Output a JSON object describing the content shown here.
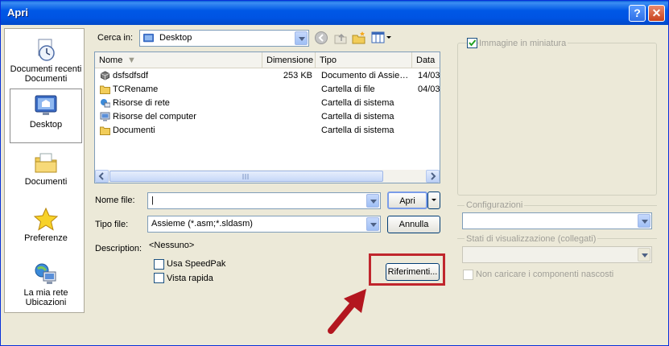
{
  "window": {
    "title": "Apri"
  },
  "title_buttons": {
    "help": "?",
    "close": "✕"
  },
  "places": [
    {
      "label": "Documenti recenti Documenti",
      "icon": "recent-documents-icon"
    },
    {
      "label": "Desktop",
      "icon": "desktop-icon"
    },
    {
      "label": "Documenti",
      "icon": "documents-folder-icon"
    },
    {
      "label": "Preferenze",
      "icon": "favorites-star-icon"
    },
    {
      "label": "La mia rete Ubicazioni",
      "icon": "network-places-icon"
    }
  ],
  "look_in": {
    "label": "Cerca in:",
    "value": "Desktop"
  },
  "file_list": {
    "columns": [
      "Nome",
      "Dimensione",
      "Tipo",
      "Data"
    ],
    "rows": [
      {
        "name": "dsfsdfsdf",
        "size": "253 KB",
        "type": "Documento di Assie…",
        "date": "14/03",
        "icon": "assembly-file-icon"
      },
      {
        "name": "TCRename",
        "size": "",
        "type": "Cartella di file",
        "date": "04/03",
        "icon": "folder-icon"
      },
      {
        "name": "Risorse di rete",
        "size": "",
        "type": "Cartella di sistema",
        "date": "",
        "icon": "network-icon"
      },
      {
        "name": "Risorse del computer",
        "size": "",
        "type": "Cartella di sistema",
        "date": "",
        "icon": "computer-icon"
      },
      {
        "name": "Documenti",
        "size": "",
        "type": "Cartella di sistema",
        "date": "",
        "icon": "folder-icon"
      }
    ]
  },
  "file_name": {
    "label": "Nome file:",
    "value": "|"
  },
  "file_type": {
    "label": "Tipo file:",
    "value": "Assieme (*.asm;*.sldasm)"
  },
  "buttons": {
    "open": "Apri",
    "cancel": "Annulla",
    "references": "Riferimenti..."
  },
  "description": {
    "label": "Description:",
    "value": "<Nessuno>"
  },
  "options": [
    {
      "label": "Usa SpeedPak",
      "checked": false
    },
    {
      "label": "Vista rapida",
      "checked": false
    }
  ],
  "right_panel": {
    "thumbnail_label": "Immagine in miniatura",
    "thumbnail_checked": true,
    "configurations_label": "Configurazioni",
    "display_states_label": "Stati di visualizzazione (collegati)",
    "hide_components_label": "Non caricare i componenti nascosti"
  },
  "colors": {
    "accent": "#0054e3",
    "highlight": "#c0262d",
    "arrow": "#b3161f"
  }
}
